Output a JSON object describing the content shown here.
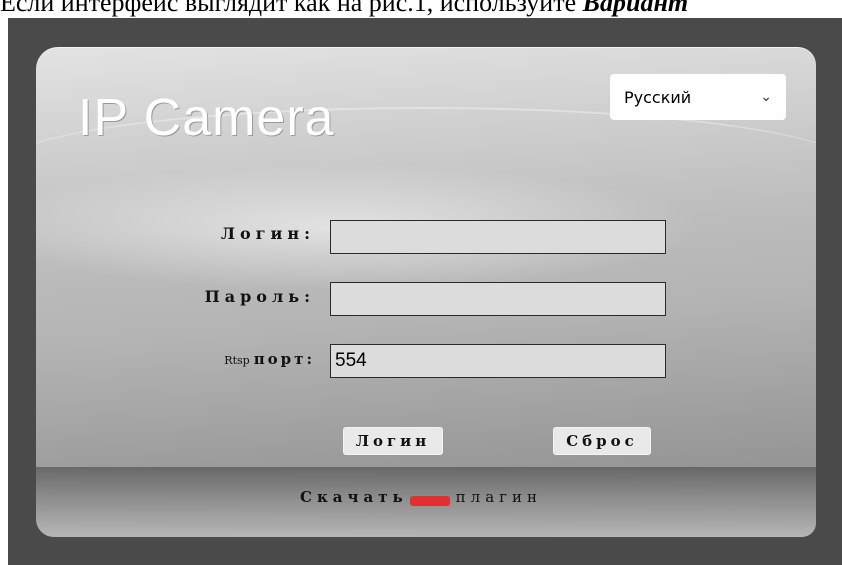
{
  "document": {
    "caption_start": "Если интерфейс выглядит как на рис.1, используйте ",
    "caption_emphasis": "Вариант"
  },
  "app": {
    "title": "IP Camera"
  },
  "language": {
    "selected": "Русский"
  },
  "form": {
    "login_label": "Логин:",
    "password_label": "Пароль:",
    "rtsp_prefix": "Rtsp",
    "rtsp_label": "порт:",
    "login_value": "",
    "password_value": "",
    "rtsp_value": "554"
  },
  "buttons": {
    "login": "Логин",
    "reset": "Сброс"
  },
  "download": {
    "before": "Скачать",
    "after": "плагин"
  },
  "colors": {
    "page_background": "#4a4a4a",
    "input_background": "#dcdcdc",
    "link_red": "#e03030"
  }
}
